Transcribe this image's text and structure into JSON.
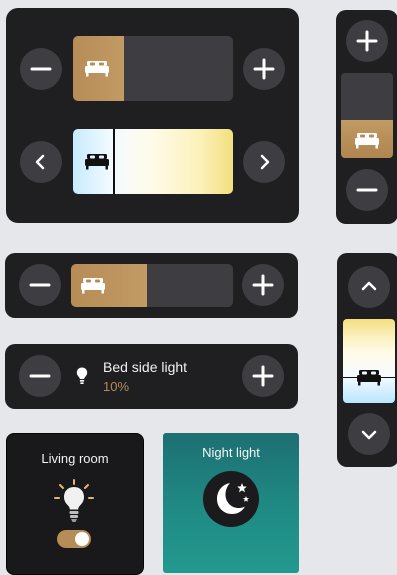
{
  "controls": {
    "minus_icon": "minus-icon",
    "plus_icon": "plus-icon",
    "left_icon": "chevron-left-icon",
    "right_icon": "chevron-right-icon",
    "up_icon": "chevron-up-icon",
    "down_icon": "chevron-down-icon",
    "bed_icon": "bed-icon"
  },
  "brightness_big": {
    "value": 0.32
  },
  "temperature_big": {
    "value": 0.25
  },
  "brightness_vertical": {
    "value": 0.45
  },
  "brightness_small": {
    "value": 0.47
  },
  "temperature_vertical": {
    "value": 0.69
  },
  "light_card": {
    "name": "Bed side light",
    "value": "10%"
  },
  "living_room": {
    "title": "Living room",
    "icon": "lightbulb-icon",
    "toggle_on": true
  },
  "night_light": {
    "title": "Night light",
    "icon": "moon-stars-icon"
  },
  "colors": {
    "card": "#1f1f22",
    "button": "#3d3d42",
    "accent_gold": "#b68c57",
    "night_teal": "#1f8b84"
  }
}
